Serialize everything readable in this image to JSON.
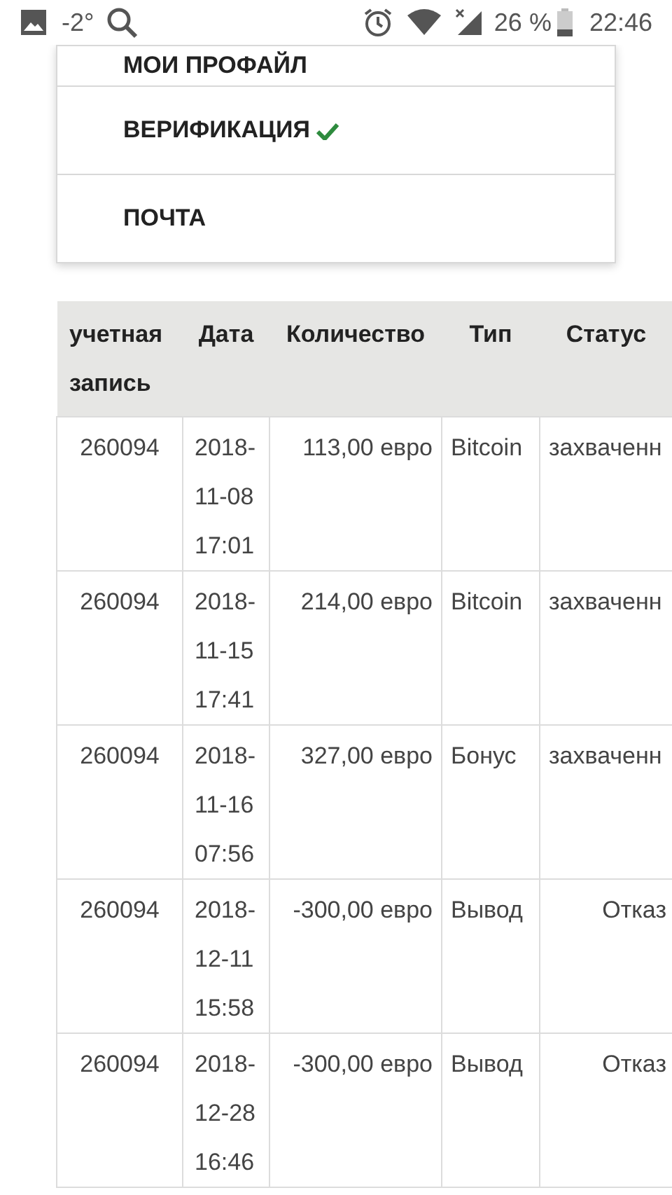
{
  "status_bar": {
    "temperature": "-2°",
    "battery": "26 %",
    "time": "22:46"
  },
  "menu": {
    "items": [
      {
        "label": "МОИ ПРОФАЙЛ",
        "verified": false
      },
      {
        "label": "ВЕРИФИКАЦИЯ",
        "verified": true
      },
      {
        "label": "ПОЧТА",
        "verified": false
      }
    ]
  },
  "table": {
    "columns": [
      "учетная запись",
      "Дата",
      "Количество",
      "Тип",
      "Статус"
    ],
    "rows": [
      {
        "account": "260094",
        "date": "2018-11-08 17:01",
        "amount": "113,00 евро",
        "type": "Bitcoin",
        "status": "захваченн",
        "kind": "captured"
      },
      {
        "account": "260094",
        "date": "2018-11-15 17:41",
        "amount": "214,00 евро",
        "type": "Bitcoin",
        "status": "захваченн",
        "kind": "captured"
      },
      {
        "account": "260094",
        "date": "2018-11-16 07:56",
        "amount": "327,00 евро",
        "type": "Бонус",
        "status": "захваченн",
        "kind": "captured"
      },
      {
        "account": "260094",
        "date": "2018-12-11 15:58",
        "amount": "-300,00 евро",
        "type": "Вывод",
        "status": "Отказ",
        "kind": "rejected"
      },
      {
        "account": "260094",
        "date": "2018-12-28 16:46",
        "amount": "-300,00 евро",
        "type": "Вывод",
        "status": "Отказ",
        "kind": "rejected"
      }
    ]
  }
}
